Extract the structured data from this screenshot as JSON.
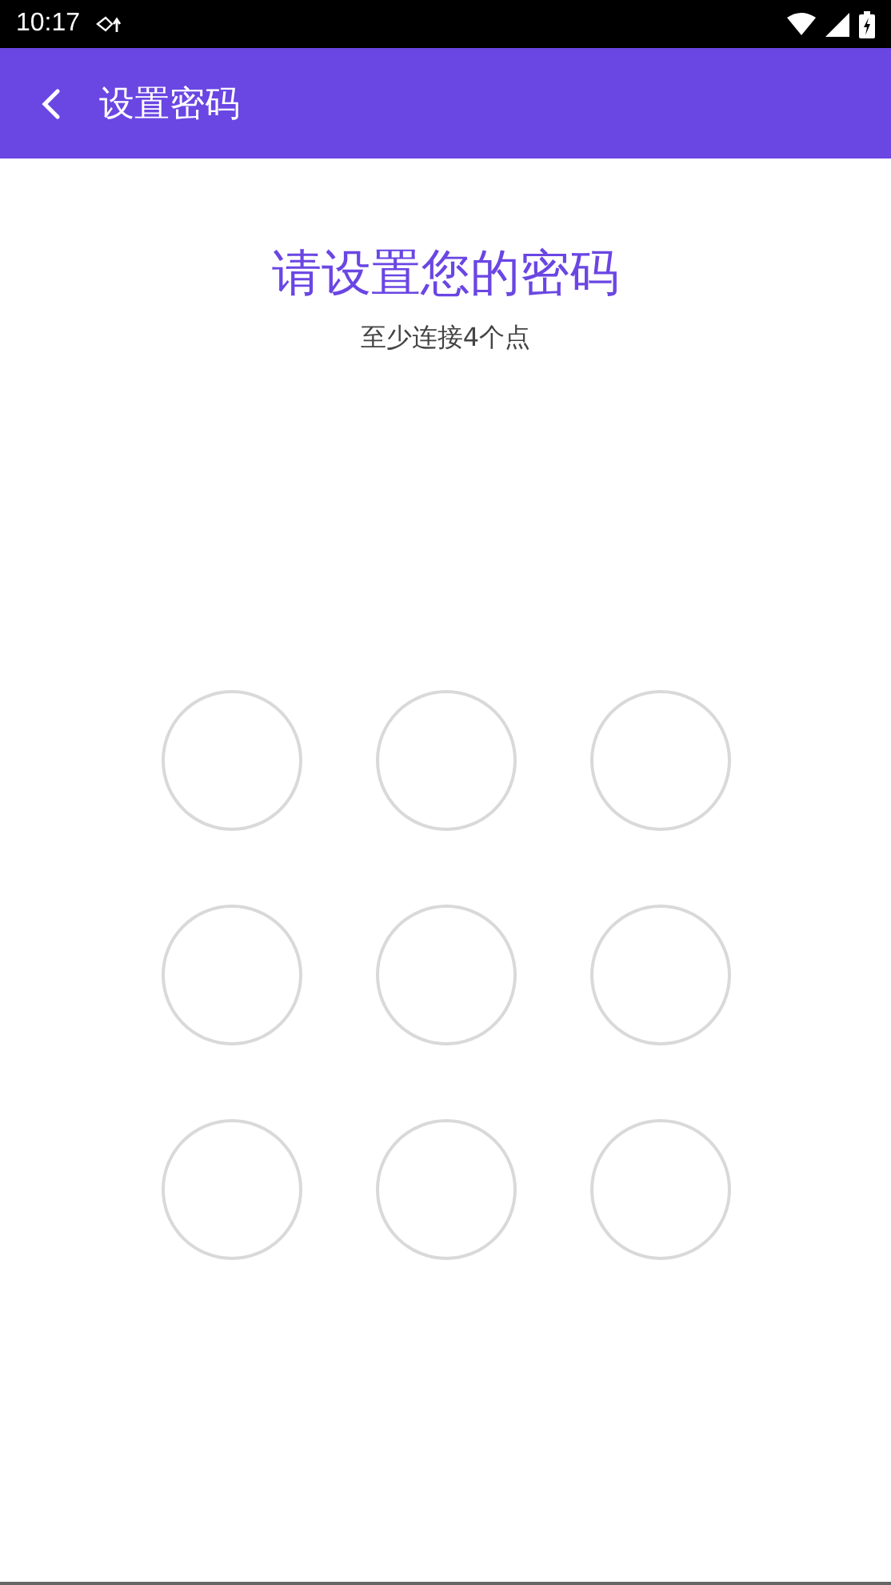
{
  "status_bar": {
    "time": "10:17"
  },
  "app_bar": {
    "title": "设置密码"
  },
  "prompt": {
    "title": "请设置您的密码",
    "hint": "至少连接4个点"
  },
  "pattern_dots": [
    {
      "selected": false
    },
    {
      "selected": false
    },
    {
      "selected": false
    },
    {
      "selected": false
    },
    {
      "selected": false
    },
    {
      "selected": false
    },
    {
      "selected": false
    },
    {
      "selected": false
    },
    {
      "selected": false
    }
  ]
}
